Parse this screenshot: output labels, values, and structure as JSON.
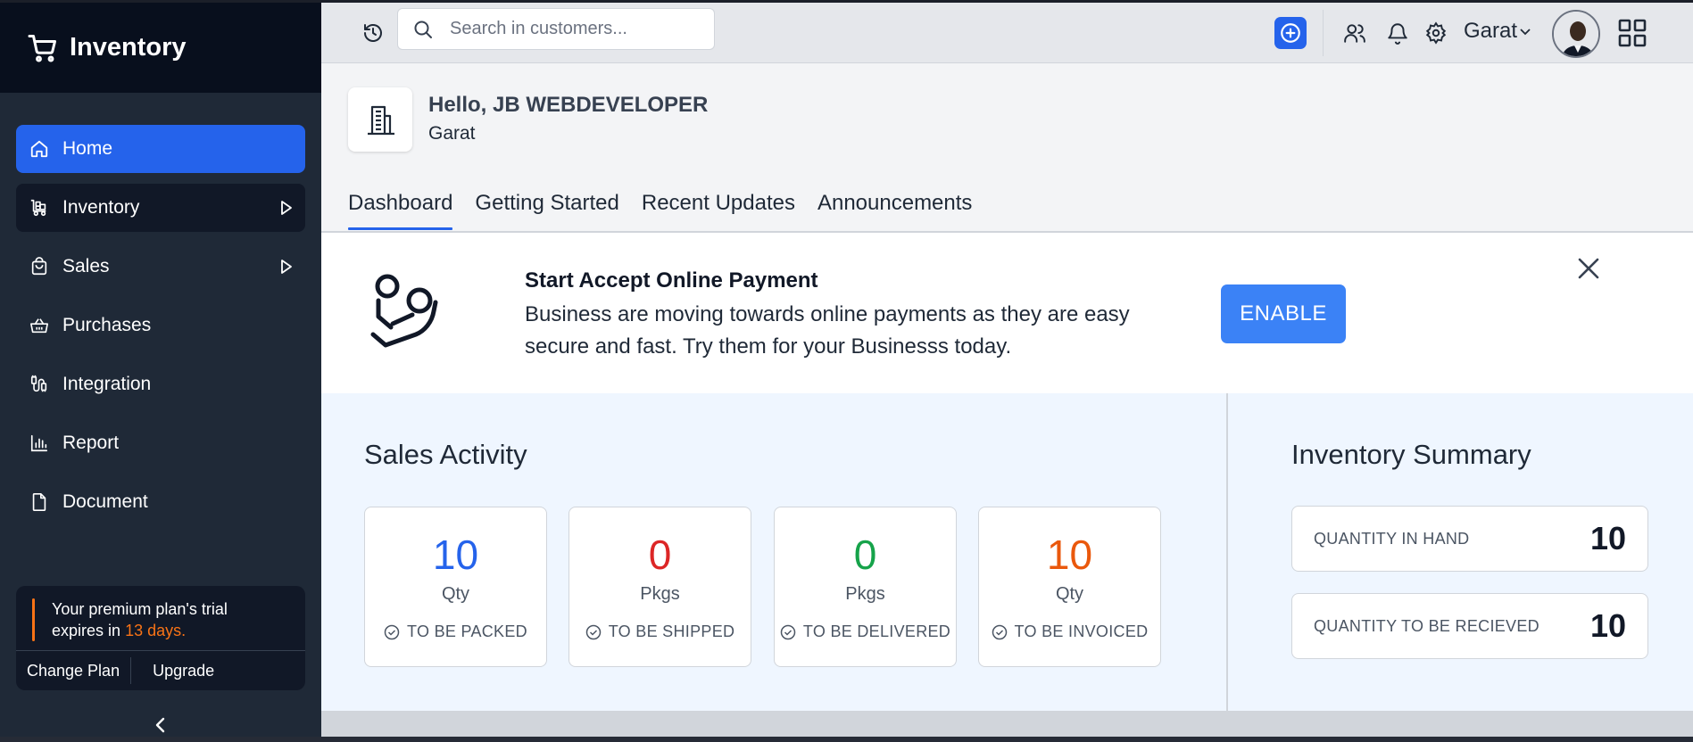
{
  "app": {
    "name": "Inventory"
  },
  "sidebar": {
    "items": [
      {
        "label": "Home",
        "icon": "home-icon"
      },
      {
        "label": "Inventory",
        "icon": "inventory-icon"
      },
      {
        "label": "Sales",
        "icon": "bag-icon"
      },
      {
        "label": "Purchases",
        "icon": "basket-icon"
      },
      {
        "label": "Integration",
        "icon": "integration-icon"
      },
      {
        "label": "Report",
        "icon": "report-icon"
      },
      {
        "label": "Document",
        "icon": "document-icon"
      }
    ],
    "trial": {
      "line1": "Your premium plan's trial",
      "line2_prefix": "expires in",
      "days": "13 days.",
      "change_plan": "Change Plan",
      "upgrade": "Upgrade"
    }
  },
  "topbar": {
    "search_placeholder": "Search in customers...",
    "org_name": "Garat"
  },
  "header": {
    "greeting": "Hello, JB WEBDEVELOPER",
    "org": "Garat"
  },
  "tabs": [
    "Dashboard",
    "Getting Started",
    "Recent Updates",
    "Announcements"
  ],
  "banner": {
    "title": "Start Accept Online Payment",
    "description": "Business are moving towards online payments as they are easy secure and fast. Try them for your Businesss today.",
    "button": "ENABLE"
  },
  "sales_activity": {
    "title": "Sales Activity",
    "cards": [
      {
        "value": "10",
        "unit": "Qty",
        "label": "TO BE PACKED",
        "color": "#2563eb"
      },
      {
        "value": "0",
        "unit": "Pkgs",
        "label": "TO BE SHIPPED",
        "color": "#dc2626"
      },
      {
        "value": "0",
        "unit": "Pkgs",
        "label": "TO BE DELIVERED",
        "color": "#16a34a"
      },
      {
        "value": "10",
        "unit": "Qty",
        "label": "TO BE INVOICED",
        "color": "#ea580c"
      }
    ]
  },
  "inventory_summary": {
    "title": "Inventory Summary",
    "items": [
      {
        "label": "QUANTITY IN HAND",
        "value": "10"
      },
      {
        "label": "QUANTITY TO BE RECIEVED",
        "value": "10"
      }
    ]
  },
  "colors": {
    "accent": "#2563eb",
    "sidebar": "#1f2937",
    "brand_bg": "#080f1d",
    "warning": "#f97316"
  }
}
